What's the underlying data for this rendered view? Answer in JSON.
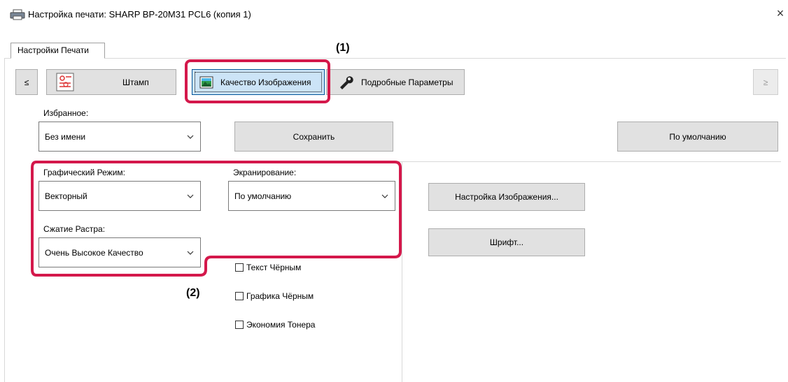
{
  "window": {
    "title": "Настройка печати: SHARP BP-20M31 PCL6 (копия 1)",
    "close_glyph": "×"
  },
  "tabs": [
    {
      "label": "Настройки Печати"
    }
  ],
  "toolbar": {
    "prev_label": "≤",
    "next_label": "≥",
    "items": [
      {
        "label": "Штамп",
        "icon": "stamp-icon"
      },
      {
        "label": "Качество Изображения",
        "icon": "image-quality-icon"
      },
      {
        "label": "Подробные Параметры",
        "icon": "wrench-icon"
      }
    ]
  },
  "callouts": {
    "one": "(1)",
    "two": "(2)"
  },
  "favorites": {
    "label": "Избранное:",
    "value": "Без имени",
    "save_label": "Сохранить",
    "default_label": "По умолчанию"
  },
  "graphics_mode": {
    "label": "Графический Режим:",
    "value": "Векторный"
  },
  "screening": {
    "label": "Экранирование:",
    "value": "По умолчанию"
  },
  "raster_compression": {
    "label": "Сжатие Растра:",
    "value": "Очень Высокое Качество"
  },
  "buttons": {
    "image_adjust": "Настройка Изображения...",
    "font": "Шрифт..."
  },
  "checkboxes": [
    {
      "label": "Текст Чёрным",
      "checked": false
    },
    {
      "label": "Графика Чёрным",
      "checked": false
    },
    {
      "label": "Экономия Тонера",
      "checked": false
    }
  ],
  "colors": {
    "highlight": "#d4184b",
    "selected_tab_bg": "#cce4f7",
    "button_bg": "#e1e1e1"
  }
}
